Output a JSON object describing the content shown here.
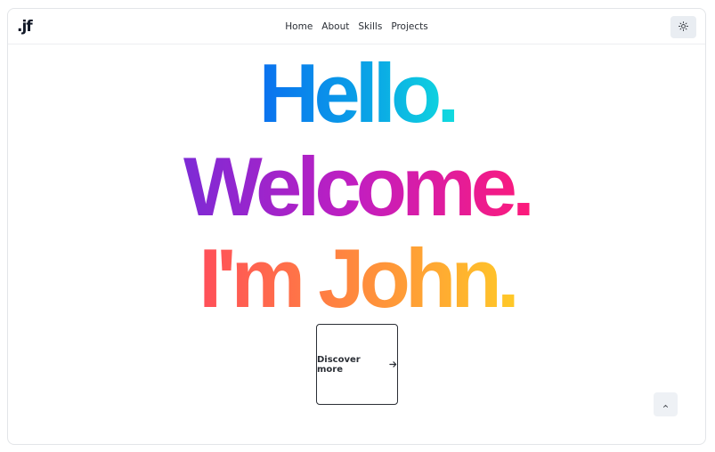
{
  "header": {
    "logo": ".jf",
    "nav": [
      {
        "label": "Home"
      },
      {
        "label": "About"
      },
      {
        "label": "Skills"
      },
      {
        "label": "Projects"
      }
    ],
    "theme_toggle_icon": "sun-icon"
  },
  "hero": {
    "line1": "Hello.",
    "line2": "Welcome.",
    "line3": "I'm John.",
    "cta_label": "Discover more",
    "cta_icon": "arrow-right-icon"
  },
  "scroll_top_icon": "chevron-up-icon",
  "colors": {
    "line1_gradient": [
      "#0a6df0",
      "#10dede"
    ],
    "line2_gradient": [
      "#7a2bd6",
      "#ff1a78"
    ],
    "line3_gradient": [
      "#ff4b5b",
      "#ffcb27"
    ],
    "text": "#2b2f36"
  }
}
